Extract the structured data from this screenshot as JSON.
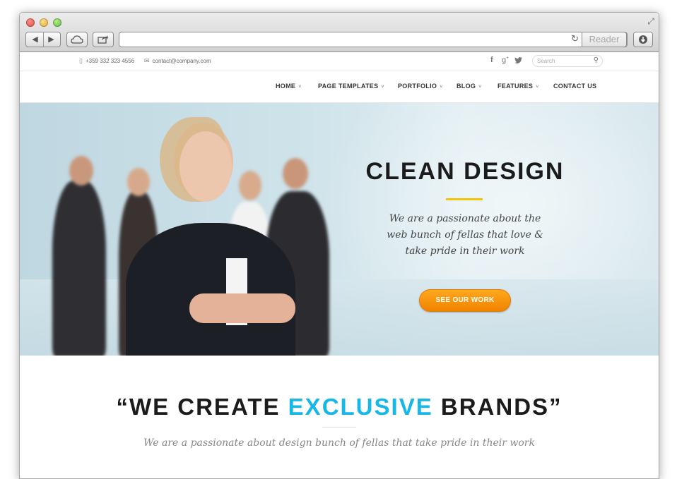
{
  "browser": {
    "reader_label": "Reader",
    "url": ""
  },
  "topbar": {
    "phone": "+359 332 323 4556",
    "email": "contact@company.com",
    "search_placeholder": "Search"
  },
  "nav": {
    "items": [
      {
        "label": "HOME"
      },
      {
        "label": "PAGE TEMPLATES"
      },
      {
        "label": "PORTFOLIO"
      },
      {
        "label": "BLOG"
      },
      {
        "label": "FEATURES"
      },
      {
        "label": "CONTACT US"
      }
    ]
  },
  "hero": {
    "title": "CLEAN DESIGN",
    "subtitle_line1": "We are a passionate about the",
    "subtitle_line2": "web bunch of fellas that love &",
    "subtitle_line3": "take pride in their work",
    "button_label": "SEE OUR WORK"
  },
  "section": {
    "title_prefix": "“WE CREATE ",
    "title_accent": "EXCLUSIVE",
    "title_suffix": " BRANDS”",
    "subtitle": "We are a passionate about design bunch of fellas that take pride in their work"
  },
  "colors": {
    "accent_blue": "#18b7e6",
    "button_orange": "#f39200",
    "divider_yellow": "#f5c400"
  }
}
